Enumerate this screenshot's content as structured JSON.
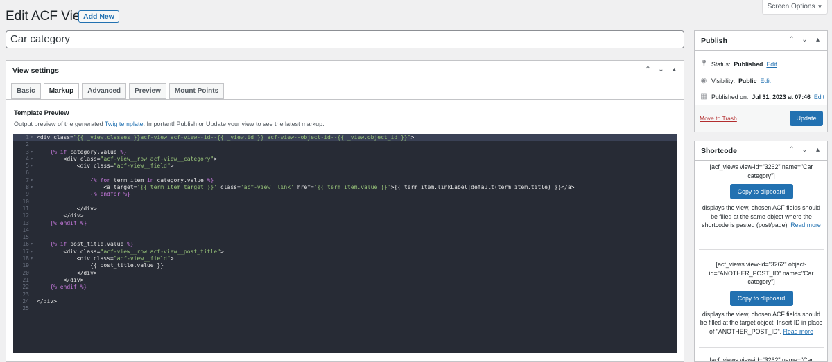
{
  "header": {
    "title": "Edit ACF View",
    "add_new": "Add New",
    "screen_options": "Screen Options",
    "screen_options_caret": "▼"
  },
  "post_title": "Car category",
  "view_settings": {
    "title": "View settings",
    "tabs": [
      "Basic",
      "Markup",
      "Advanced",
      "Preview",
      "Mount Points"
    ],
    "active_tab": "Markup",
    "section_label": "Template Preview",
    "desc_before": "Output preview of the generated ",
    "desc_link": "Twig template",
    "desc_after": ". Important! Publish or Update your view to see the latest markup."
  },
  "code_lines": [
    "<div class=\"{{ _view.classes }}acf-view acf-view--id--{{ _view.id }} acf-view--object-id--{{ _view.object_id }}\">",
    "",
    "    {% if category.value %}",
    "        <div class=\"acf-view__row acf-view__category\">",
    "            <div class=\"acf-view__field\">",
    "",
    "                {% for term_item in category.value %}",
    "                    <a target='{{ term_item.target }}' class='acf-view__link' href='{{ term_item.value }}'>{{ term_item.linkLabel|default(term_item.title) }}</a>",
    "                {% endfor %}",
    "",
    "            </div>",
    "        </div>",
    "    {% endif %}",
    "",
    "",
    "    {% if post_title.value %}",
    "        <div class=\"acf-view__row acf-view__post_title\">",
    "            <div class=\"acf-view__field\">",
    "                {{ post_title.value }}",
    "            </div>",
    "        </div>",
    "    {% endif %}",
    "",
    "</div>",
    ""
  ],
  "publish": {
    "title": "Publish",
    "status_label": "Status:",
    "status_value": "Published",
    "visibility_label": "Visibility:",
    "visibility_value": "Public",
    "published_label": "Published on:",
    "published_value": "Jul 31, 2023 at 07:46",
    "edit": "Edit",
    "trash": "Move to Trash",
    "update": "Update"
  },
  "shortcode": {
    "title": "Shortcode",
    "copy": "Copy to clipboard",
    "read_more": "Read more",
    "items": [
      {
        "code": "[acf_views view-id=\"3262\" name=\"Car category\"]",
        "desc": "displays the view, chosen ACF fields should be filled at the same object where the shortcode is pasted (post/page). "
      },
      {
        "code": "[acf_views view-id=\"3262\" object-id=\"ANOTHER_POST_ID\" name=\"Car category\"]",
        "desc": "displays the view, chosen ACF fields should be filled at the target object. Insert ID in place of \"ANOTHER_POST_ID\". "
      },
      {
        "code": "[acf_views view-id=\"3262\" name=\"Car",
        "desc": ""
      }
    ]
  },
  "icons": {
    "up": "⌃",
    "down": "⌄",
    "toggle": "▴",
    "fold": "▾"
  },
  "colors": {
    "accent": "#2271b1",
    "editor_bg": "#272b35",
    "trash": "#b32d2e"
  }
}
